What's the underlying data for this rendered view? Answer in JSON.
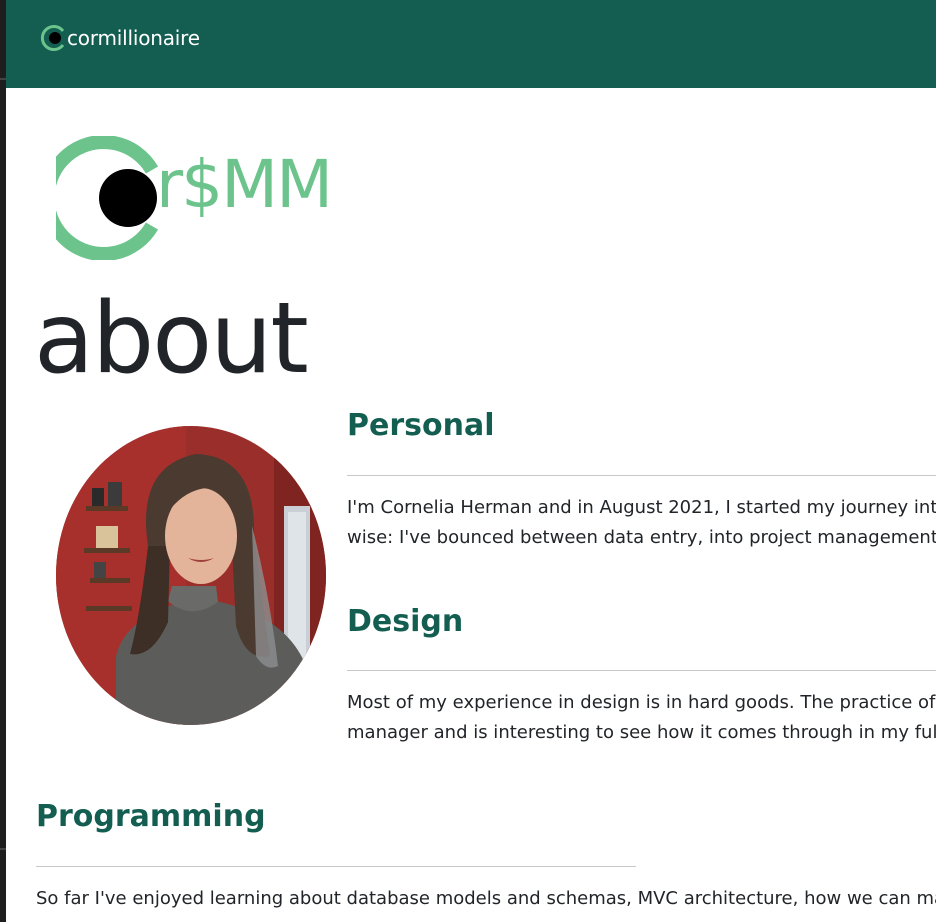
{
  "navbar": {
    "brand_text": "cormillionaire",
    "background": "#135e50"
  },
  "logo": {
    "letters": "r$MM",
    "color": "#6cc48c"
  },
  "page_title": "about",
  "sections": {
    "personal": {
      "heading": "Personal",
      "lines": [
        "I'm Cornelia Herman and in August 2021, I started my journey into",
        "wise: I've bounced between data entry, into project management, t"
      ]
    },
    "design": {
      "heading": "Design",
      "lines": [
        "Most of my experience in design is in hard goods. The practice of c",
        "manager and is interesting to see how it comes through in my full-"
      ]
    },
    "programming": {
      "heading": "Programming",
      "lines": [
        "So far I've enjoyed learning about database models and schemas, MVC architecture, how we can manip"
      ]
    }
  },
  "colors": {
    "accent": "#135e50",
    "logo_green": "#6cc48c",
    "text": "#212529"
  }
}
